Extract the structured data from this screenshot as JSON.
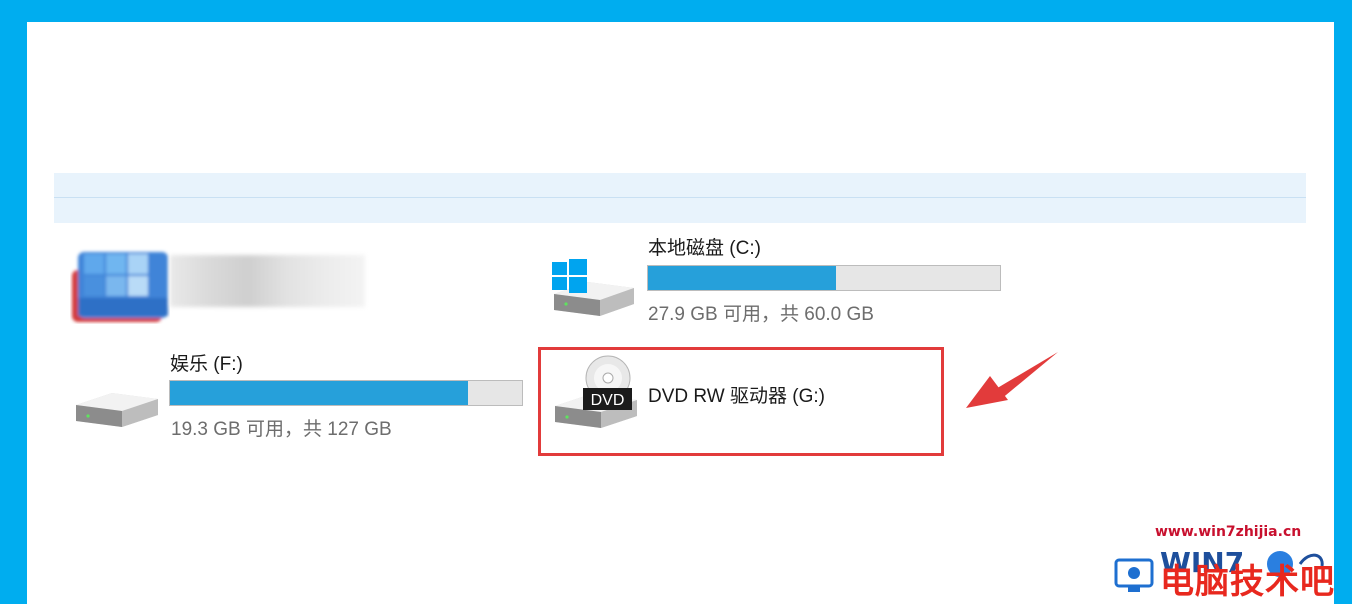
{
  "drives": [
    {
      "name": "",
      "space": "",
      "icon": "blurred-drive-icon"
    },
    {
      "name": "本地磁盘 (C:)",
      "space": "27.9 GB 可用，共 60.0 GB",
      "used_fraction": 0.535,
      "icon": "windows-drive-icon"
    },
    {
      "name": "娱乐 (F:)",
      "space": "19.3 GB 可用，共 127 GB",
      "used_fraction": 0.848,
      "icon": "hard-drive-icon"
    },
    {
      "name": "DVD RW 驱动器 (G:)",
      "icon": "dvd-drive-icon",
      "icon_label": "DVD"
    }
  ],
  "watermark": {
    "url": "www.win7zhijia.cn",
    "text": "电脑技术吧"
  },
  "colors": {
    "frame": "#00adef",
    "bar_fill": "#26a0da",
    "highlight": "#e23b3b"
  }
}
